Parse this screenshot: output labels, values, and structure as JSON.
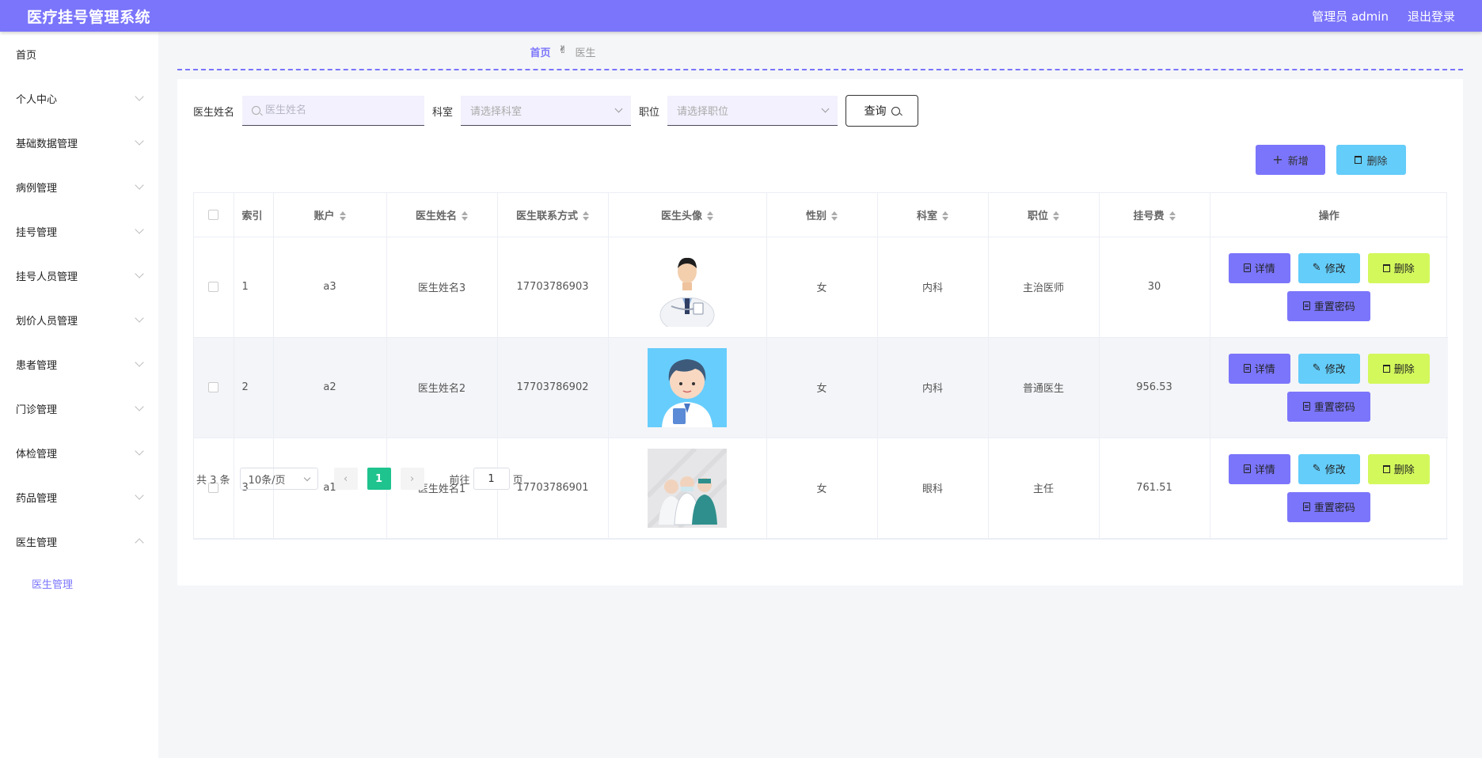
{
  "header": {
    "title": "医疗挂号管理系统",
    "user": "管理员 admin",
    "logout": "退出登录",
    "bg_color": "#7b75fb"
  },
  "sidebar": {
    "items": [
      {
        "label": "首页",
        "has_arrow": false
      },
      {
        "label": "个人中心",
        "has_arrow": true
      },
      {
        "label": "基础数据管理",
        "has_arrow": true
      },
      {
        "label": "病例管理",
        "has_arrow": true
      },
      {
        "label": "挂号管理",
        "has_arrow": true
      },
      {
        "label": "挂号人员管理",
        "has_arrow": true
      },
      {
        "label": "划价人员管理",
        "has_arrow": true
      },
      {
        "label": "患者管理",
        "has_arrow": true
      },
      {
        "label": "门诊管理",
        "has_arrow": true
      },
      {
        "label": "体检管理",
        "has_arrow": true
      },
      {
        "label": "药品管理",
        "has_arrow": true
      },
      {
        "label": "医生管理",
        "has_arrow": true,
        "expanded": true
      }
    ],
    "sub_item": "医生管理"
  },
  "breadcrumb": {
    "home": "首页",
    "sep": "✌",
    "current": "医生"
  },
  "search": {
    "name_label": "医生姓名",
    "name_placeholder": "医生姓名",
    "dept_label": "科室",
    "dept_placeholder": "请选择科室",
    "pos_label": "职位",
    "pos_placeholder": "请选择职位",
    "query_label": "查询"
  },
  "toolbar": {
    "add_label": "新增",
    "delete_label": "删除"
  },
  "table": {
    "columns": [
      "索引",
      "账户",
      "医生姓名",
      "医生联系方式",
      "医生头像",
      "性别",
      "科室",
      "职位",
      "挂号费",
      "操作"
    ],
    "rows": [
      {
        "index": "1",
        "account": "a3",
        "name": "医生姓名3",
        "phone": "17703786903",
        "gender": "女",
        "dept": "内科",
        "position": "主治医师",
        "fee": "30",
        "avatar": "doctor-photo"
      },
      {
        "index": "2",
        "account": "a2",
        "name": "医生姓名2",
        "phone": "17703786902",
        "gender": "女",
        "dept": "内科",
        "position": "普通医生",
        "fee": "956.53",
        "avatar": "doctor-cartoon"
      },
      {
        "index": "3",
        "account": "a1",
        "name": "医生姓名1",
        "phone": "17703786901",
        "gender": "女",
        "dept": "眼科",
        "position": "主任",
        "fee": "761.51",
        "avatar": "medical-team"
      }
    ],
    "ops": {
      "detail": "详情",
      "edit": "修改",
      "delete": "删除",
      "reset": "重置密码"
    }
  },
  "pager": {
    "total": "共 3 条",
    "size": "10条/页",
    "current": "1",
    "goto_prefix": "前往",
    "goto_value": "1",
    "goto_suffix": "页",
    "active_color": "#1fc38e"
  }
}
